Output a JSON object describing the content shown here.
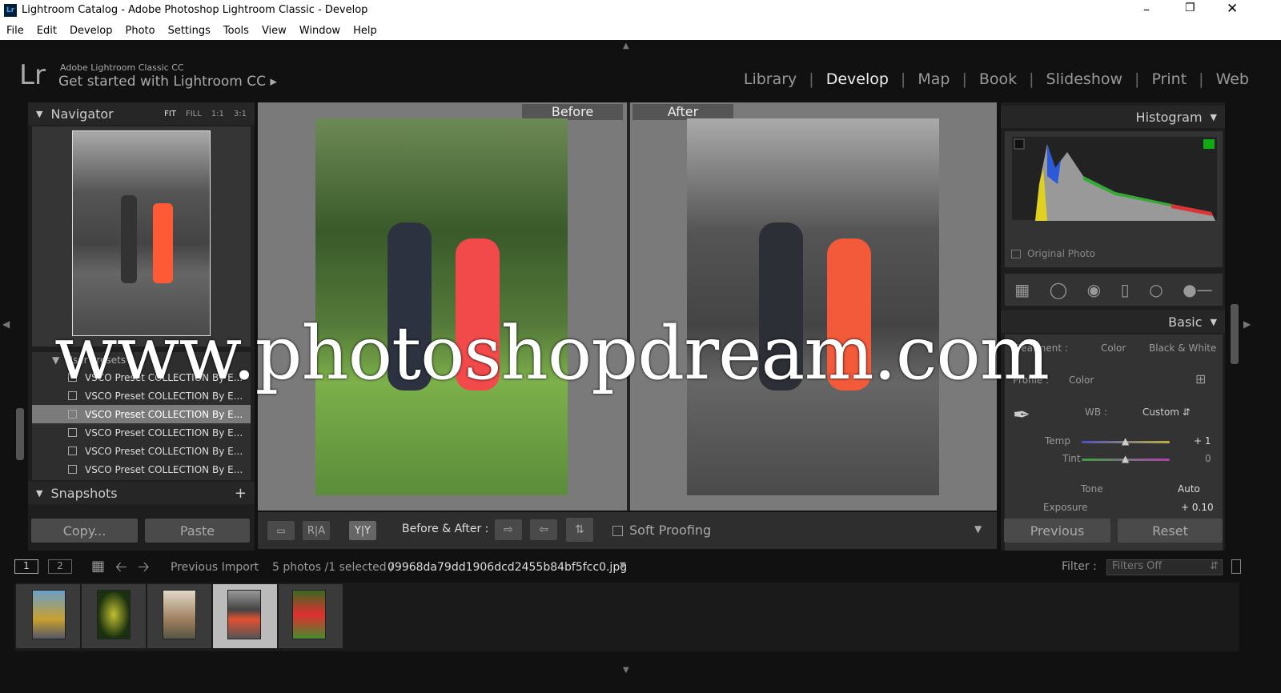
{
  "window": {
    "title": "Lightroom Catalog - Adobe Photoshop Lightroom Classic - Develop",
    "app_icon": "Lr",
    "controls": [
      "minimize",
      "maximize",
      "close"
    ]
  },
  "menu": [
    "File",
    "Edit",
    "Develop",
    "Photo",
    "Settings",
    "Tools",
    "View",
    "Window",
    "Help"
  ],
  "identity": {
    "logo": "Lr",
    "product": "Adobe Lightroom Classic CC",
    "tagline": "Get started with Lightroom CC"
  },
  "modules": [
    "Library",
    "Develop",
    "Map",
    "Book",
    "Slideshow",
    "Print",
    "Web"
  ],
  "active_module": "Develop",
  "navigator": {
    "title": "Navigator",
    "zoom": [
      "FIT",
      "FILL",
      "1:1",
      "3:1"
    ]
  },
  "presets": {
    "group": "User Presets",
    "items": [
      "VSCO Preset COLLECTION By E...",
      "VSCO Preset COLLECTION By E...",
      "VSCO Preset COLLECTION By E...",
      "VSCO Preset COLLECTION By E...",
      "VSCO Preset COLLECTION By E...",
      "VSCO Preset COLLECTION By E..."
    ],
    "selected_index": 2
  },
  "snapshots": {
    "title": "Snapshots",
    "add": "+"
  },
  "left_buttons": {
    "copy": "Copy...",
    "paste": "Paste"
  },
  "view": {
    "before": "Before",
    "after": "After"
  },
  "toolbar": {
    "before_after_label": "Before & After :",
    "soft_proofing": "Soft Proofing",
    "soft_proofing_checked": false
  },
  "histogram": {
    "title": "Histogram",
    "original_photo": "Original Photo"
  },
  "basic": {
    "title": "Basic",
    "treatment_label": "Treatment :",
    "treatment_color": "Color",
    "treatment_bw": "Black & White",
    "profile_label": "Profile :",
    "profile_value": "Color",
    "wb_label": "WB :",
    "wb_value": "Custom",
    "temp_label": "Temp",
    "temp_value": "+ 1",
    "tint_label": "Tint",
    "tint_value": "0",
    "tone_label": "Tone",
    "auto": "Auto",
    "exposure_label": "Exposure",
    "exposure_value": "+ 0.10"
  },
  "right_buttons": {
    "previous": "Previous",
    "reset": "Reset"
  },
  "filmstrip": {
    "pages": [
      "1",
      "2"
    ],
    "source": "Previous Import",
    "count": "5 photos /1 selected /",
    "filename": "09968da79dd1906dcd2455b84bf5fcc0.jpg",
    "filter_label": "Filter :",
    "filter_value": "Filters Off",
    "selected_index": 3
  },
  "watermark": "www.photoshopdream.com"
}
